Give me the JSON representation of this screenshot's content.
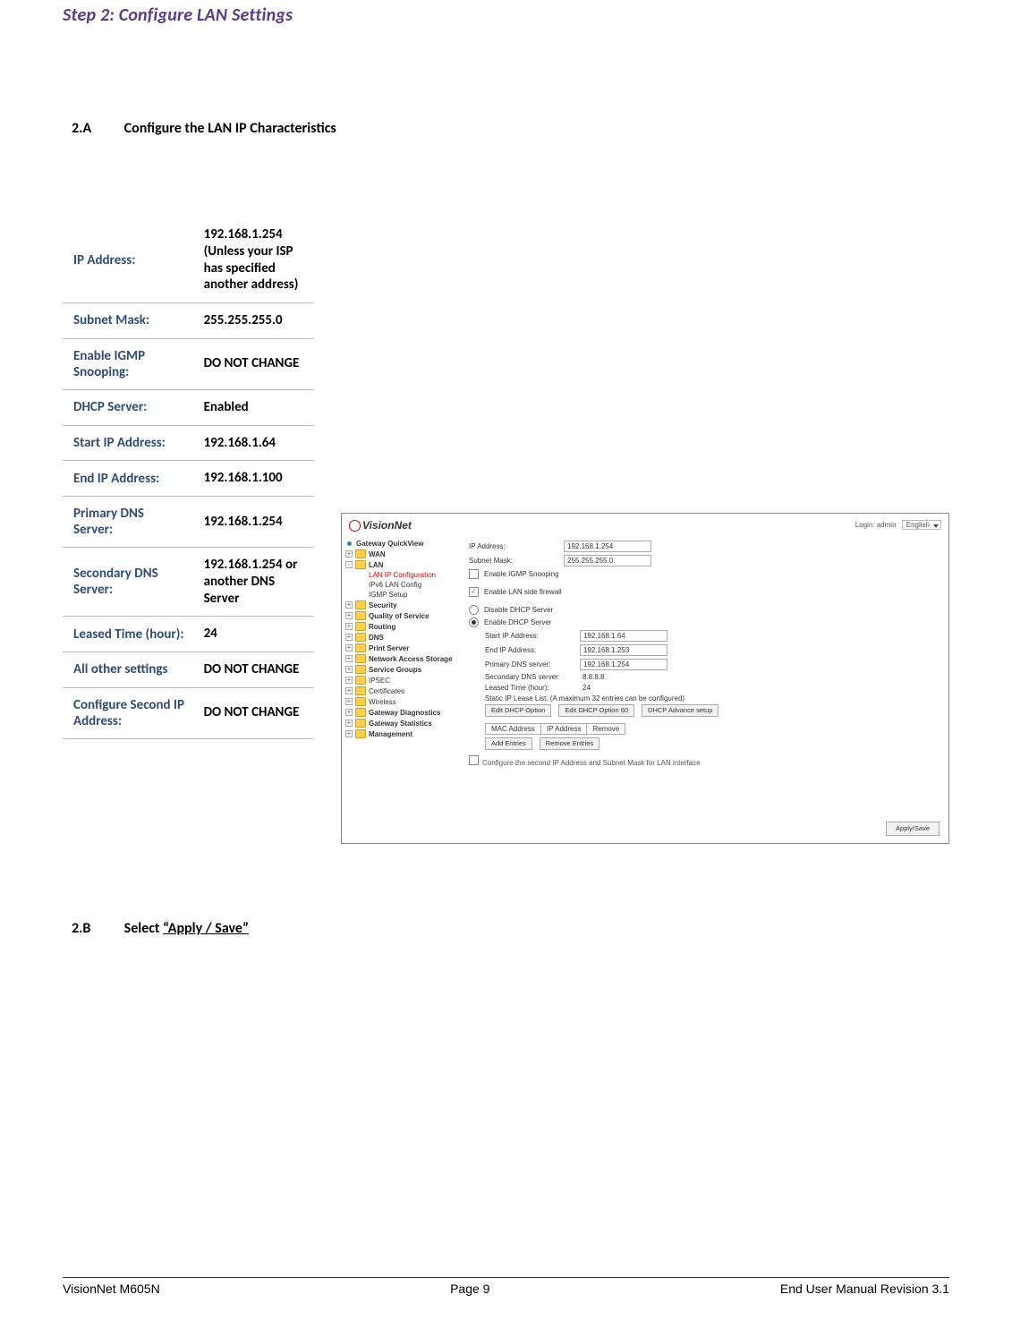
{
  "step_title": "Step 2: Configure LAN Settings",
  "section_a": {
    "num": "2.A",
    "text": "Configure the LAN IP Characteristics"
  },
  "section_b": {
    "num": "2.B",
    "prefix": "Select ",
    "link": "“Apply / Save”"
  },
  "settings": [
    {
      "label": "IP Address:",
      "value": "192.168.1.254 (Unless your ISP has specified another address)"
    },
    {
      "label": "Subnet Mask:",
      "value": "255.255.255.0"
    },
    {
      "label": "Enable IGMP Snooping:",
      "value": "DO NOT CHANGE"
    },
    {
      "label": "DHCP Server:",
      "value": "Enabled"
    },
    {
      "label": "Start IP Address:",
      "value": "192.168.1.64"
    },
    {
      "label": "End IP Address:",
      "value": "192.168.1.100"
    },
    {
      "label": "Primary DNS Server:",
      "value": "192.168.1.254"
    },
    {
      "label": "Secondary DNS Server:",
      "value": "192.168.1.254 or another DNS Server"
    },
    {
      "label": "Leased Time (hour):",
      "value": "24"
    },
    {
      "label": "All other settings",
      "value": "DO NOT CHANGE"
    },
    {
      "label": "Configure Second IP Address:",
      "value": "DO NOT CHANGE"
    }
  ],
  "shot": {
    "brand": "VisionNet",
    "login_label": "Login: admin",
    "lang": "English",
    "tree": {
      "gateway_quickview": "Gateway QuickView",
      "wan": "WAN",
      "lan": "LAN",
      "lan_ip_config": "LAN IP Configuration",
      "ipv6_lan": "IPv6 LAN Config",
      "igmp_snoop": "IGMP Setup",
      "security": "Security",
      "qos": "Quality of Service",
      "routing": "Routing",
      "dns": "DNS",
      "print": "Print Server",
      "nas": "Network Access Storage",
      "svc_groups": "Service Groups",
      "ipsec": "IPSEC",
      "certs": "Certificates",
      "wireless": "Wireless",
      "gw_diag": "Gateway Diagnostics",
      "gw_stats": "Gateway Statistics",
      "mgmt": "Management"
    },
    "form": {
      "ip_label": "IP Address:",
      "ip_val": "192.168.1.254",
      "mask_label": "Subnet Mask:",
      "mask_val": "255.255.255.0",
      "igmp_label": "Enable IGMP Snooping",
      "fw_label": "Enable LAN side firewall",
      "dhcp_disable": "Disable DHCP Server",
      "dhcp_enable": "Enable DHCP Server",
      "start_ip_label": "Start IP Address:",
      "start_ip_val": "192.168.1.64",
      "end_ip_label": "End IP Address:",
      "end_ip_val": "192.168.1.253",
      "pdns_label": "Primary DNS server:",
      "pdns_val": "192.168.1.254",
      "sdns_label": "Secondary DNS server:",
      "sdns_val": "8.8.8.8",
      "lease_label": "Leased Time (hour):",
      "lease_val": "24",
      "static_note": "Static IP Lease List: (A maximum 32 entries can be configured)",
      "btn_edit_opt": "Edit DHCP Option",
      "btn_edit_opt60": "Edit DHCP Option 60",
      "btn_adv": "DHCP Advance setup",
      "th_mac": "MAC Address",
      "th_ip": "IP Address",
      "th_rm": "Remove",
      "btn_add": "Add Entries",
      "btn_remove": "Remove Entries",
      "second_ip_label": "Configure the second IP Address and Subnet Mask for LAN interface",
      "apply": "Apply/Save"
    }
  },
  "footer": {
    "left": "VisionNet M605N",
    "center": "Page 9",
    "right": "End User Manual Revision 3.1"
  }
}
